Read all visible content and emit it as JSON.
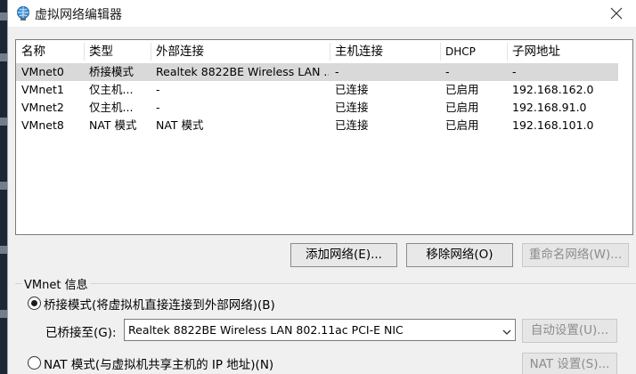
{
  "window": {
    "title": "虚拟网络编辑器"
  },
  "table": {
    "columns": [
      "名称",
      "类型",
      "外部连接",
      "主机连接",
      "DHCP",
      "子网地址"
    ],
    "rows": [
      {
        "name": "VMnet0",
        "type": "桥接模式",
        "external": "Realtek 8822BE Wireless LAN ...",
        "host": "-",
        "dhcp": "-",
        "subnet": "-",
        "selected": true
      },
      {
        "name": "VMnet1",
        "type": "仅主机...",
        "external": "-",
        "host": "已连接",
        "dhcp": "已启用",
        "subnet": "192.168.162.0",
        "selected": false
      },
      {
        "name": "VMnet2",
        "type": "仅主机...",
        "external": "-",
        "host": "已连接",
        "dhcp": "已启用",
        "subnet": "192.168.91.0",
        "selected": false
      },
      {
        "name": "VMnet8",
        "type": "NAT 模式",
        "external": "NAT 模式",
        "host": "已连接",
        "dhcp": "已启用",
        "subnet": "192.168.101.0",
        "selected": false
      }
    ]
  },
  "buttons": {
    "add": "添加网络(E)...",
    "remove": "移除网络(O)",
    "rename": "重命名网络(W)...",
    "auto": "自动设置(U)...",
    "nat": "NAT 设置(S)..."
  },
  "vmnet_info": {
    "label": "VMnet 信息",
    "bridged_option": "桥接模式(将虚拟机直接连接到外部网络)(B)",
    "bridged_selected": true,
    "bridged_to_label": "已桥接至(G):",
    "bridged_to_value": "Realtek 8822BE Wireless LAN 802.11ac PCI-E NIC",
    "nat_option": "NAT 模式(与虚拟机共享主机的 IP 地址)(N)"
  },
  "colors": {
    "selected_row": "#d9d9d9",
    "dialog_bg": "#f0f0f0"
  },
  "icons": {
    "title": "network-globe-icon",
    "close": "close-icon",
    "dropdown": "chevron-down-icon"
  }
}
